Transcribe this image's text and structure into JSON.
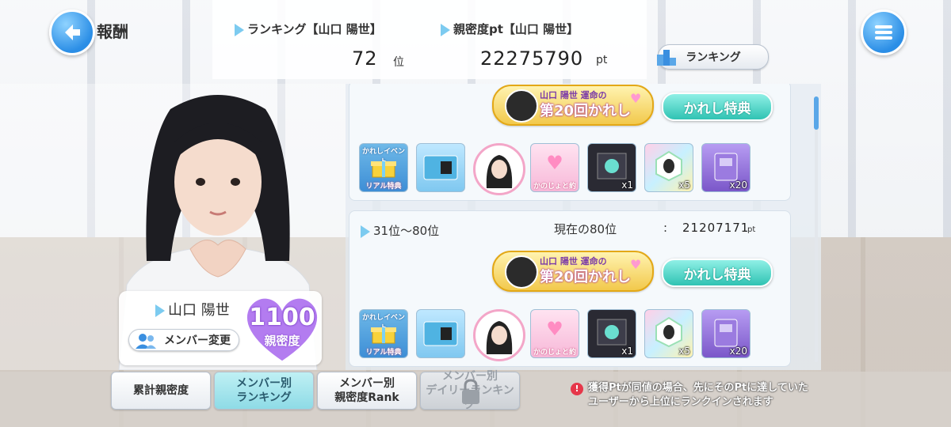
{
  "header": {
    "screen_title": "報酬",
    "ranking_label": "ランキング【山口 陽世】",
    "ranking_value": "72",
    "ranking_unit": "位",
    "pt_label": "親密度pt【山口 陽世】",
    "pt_value": "22275790",
    "pt_unit": "pt",
    "ranking_button": "ランキング"
  },
  "member": {
    "name": "山口 陽世",
    "change_button": "メンバー変更",
    "intimacy_value": "1100",
    "intimacy_label": "親密度"
  },
  "reward_cards": [
    {
      "event_banner_top": "山口 陽世 運命の",
      "event_banner_main": "第20回かれし",
      "kareshi_button": "かれし特典",
      "rewards": [
        {
          "icon": "real-perk-giftbox-icon",
          "caption": "リアル特典",
          "top_caption": "かれしイベント",
          "qty": ""
        },
        {
          "icon": "membership-card-icon",
          "caption": "",
          "top_caption": "",
          "qty": ""
        },
        {
          "icon": "member-portrait-icon",
          "caption": "",
          "top_caption": "",
          "qty": ""
        },
        {
          "icon": "promise-hands-icon",
          "caption": "かのじょと約束",
          "top_caption": "",
          "qty": ""
        },
        {
          "icon": "photo-ticket-icon",
          "caption": "",
          "top_caption": "",
          "qty": "x1"
        },
        {
          "icon": "rainbow-card-icon",
          "caption": "",
          "top_caption": "",
          "qty": "x5"
        },
        {
          "icon": "purple-book-icon",
          "caption": "",
          "top_caption": "",
          "qty": "x20"
        }
      ]
    },
    {
      "rank_range": "31位～80位",
      "current_label": "現在の80位",
      "colon": ":",
      "current_pt": "21207171",
      "current_unit": "pt",
      "event_banner_top": "山口 陽世 運命の",
      "event_banner_main": "第20回かれし",
      "kareshi_button": "かれし特典",
      "rewards": [
        {
          "icon": "real-perk-giftbox-icon",
          "caption": "リアル特典",
          "top_caption": "かれしイベント",
          "qty": ""
        },
        {
          "icon": "membership-card-icon",
          "caption": "",
          "top_caption": "",
          "qty": ""
        },
        {
          "icon": "member-portrait-icon",
          "caption": "",
          "top_caption": "",
          "qty": ""
        },
        {
          "icon": "promise-hands-icon",
          "caption": "かのじょと約束",
          "top_caption": "",
          "qty": ""
        },
        {
          "icon": "photo-ticket-icon",
          "caption": "",
          "top_caption": "",
          "qty": "x1"
        },
        {
          "icon": "rainbow-card-icon",
          "caption": "",
          "top_caption": "",
          "qty": "x5"
        },
        {
          "icon": "purple-book-icon",
          "caption": "",
          "top_caption": "",
          "qty": "x20"
        }
      ]
    }
  ],
  "tabs": [
    {
      "line1": "累計親密度",
      "line2": ""
    },
    {
      "line1": "メンバー別",
      "line2": "ランキング"
    },
    {
      "line1": "メンバー別",
      "line2": "親密度Rank"
    },
    {
      "line1": "メンバー別",
      "line2": "デイリーランキング"
    }
  ],
  "notice": {
    "line1": "獲得Ptが同値の場合、先にそのPtに達していた",
    "line2": "ユーザーから上位にランクインされます"
  },
  "colors": {
    "accent_blue": "#2b8ee6",
    "teal_button": "#2fc3b3",
    "heart_purple": "#b37cf0",
    "notice_red": "#e6374a"
  }
}
